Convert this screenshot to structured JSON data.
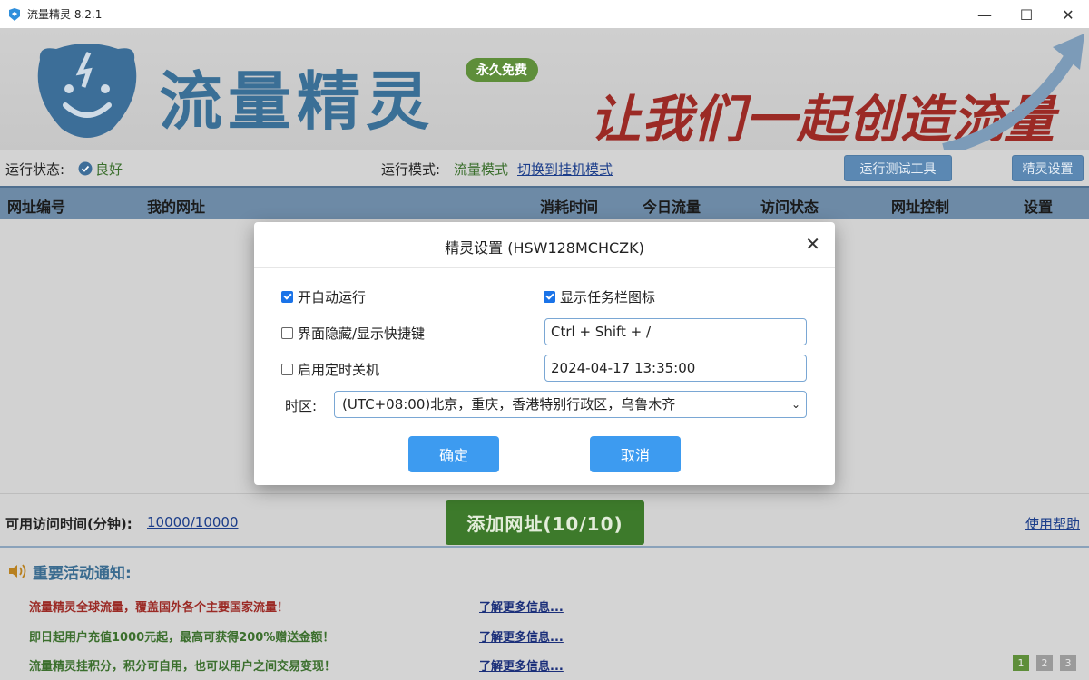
{
  "window": {
    "title": "流量精灵 8.2.1",
    "min_icon": "minimize-icon",
    "max_icon": "maximize-icon",
    "close_icon": "close-icon"
  },
  "banner": {
    "brand": "流量精灵",
    "badge": "永久免费",
    "slogan": "让我们一起创造流量"
  },
  "status": {
    "run_status_label": "运行状态:",
    "run_status_value": "良好",
    "run_mode_label": "运行模式:",
    "run_mode_value": "流量模式",
    "switch_mode_link": "切换到挂机模式",
    "test_tool_button": "运行测试工具",
    "settings_button": "精灵设置"
  },
  "table": {
    "headers": [
      "网址编号",
      "我的网址",
      "消耗时间",
      "今日流量",
      "访问状态",
      "网址控制",
      "设置"
    ]
  },
  "bottom": {
    "time_label": "可用访问时间(分钟):",
    "time_value": "10000/10000",
    "add_button": "添加网址(10/10)",
    "help_link": "使用帮助"
  },
  "notice": {
    "title": "重要活动通知:",
    "items": [
      {
        "text": "流量精灵全球流量，覆盖国外各个主要国家流量！",
        "link": "了解更多信息...",
        "color": "#9b2a25"
      },
      {
        "text": "即日起用户充值1000元起，最高可获得200%赠送金额！",
        "link": "了解更多信息...",
        "color": "#3b6f2d"
      },
      {
        "text": "流量精灵挂积分，积分可自用，也可以用户之间交易变现！",
        "link": "了解更多信息...",
        "color": "#3b6f2d"
      }
    ],
    "pages": [
      "1",
      "2",
      "3"
    ]
  },
  "dialog": {
    "title": "精灵设置 (HSW128MCHCZK)",
    "auto_run_label": "开自动运行",
    "auto_run_checked": true,
    "show_tray_label": "显示任务栏图标",
    "show_tray_checked": true,
    "hotkey_label": "界面隐藏/显示快捷键",
    "hotkey_checked": false,
    "hotkey_value": "Ctrl + Shift + /",
    "shutdown_label": "启用定时关机",
    "shutdown_checked": false,
    "shutdown_value": "2024-04-17 13:35:00",
    "timezone_label": "时区:",
    "timezone_value": "(UTC+08:00)北京，重庆，香港特别行政区，乌鲁木齐",
    "ok_button": "确定",
    "cancel_button": "取消"
  },
  "colors": {
    "accent": "#3d9bf0",
    "brand_blue": "#3a6f96",
    "checkbox": "#1a73e8",
    "add_green": "#3d7a2b"
  }
}
